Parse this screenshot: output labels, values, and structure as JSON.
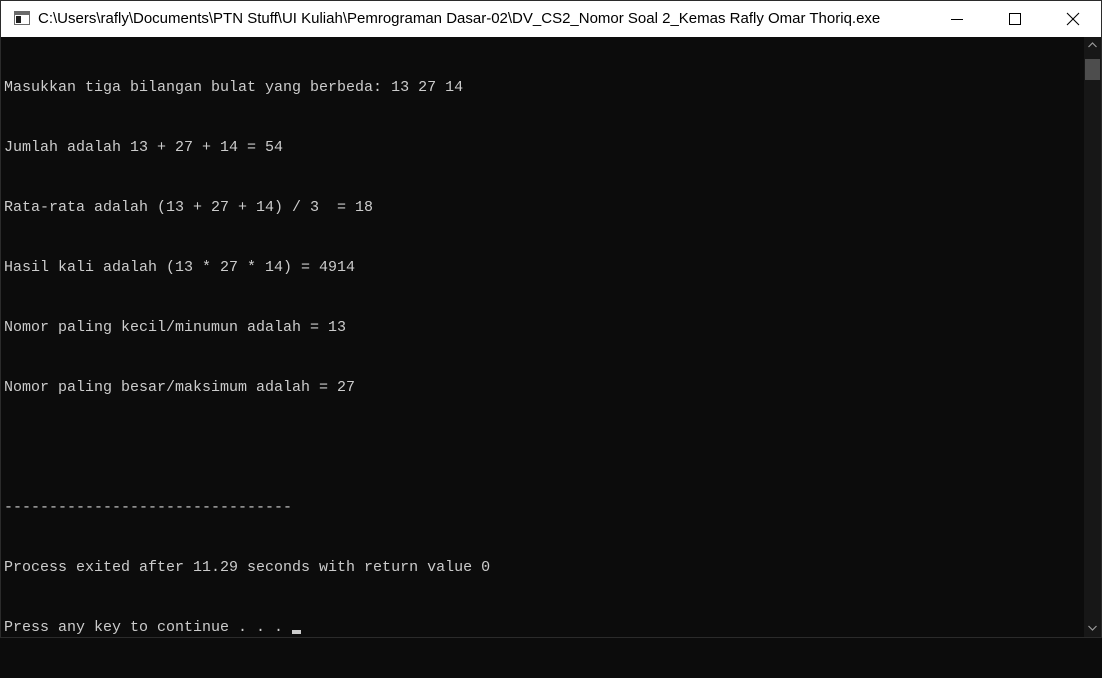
{
  "window": {
    "title": "C:\\Users\\rafly\\Documents\\PTN Stuff\\UI Kuliah\\Pemrograman Dasar-02\\DV_CS2_Nomor Soal 2_Kemas Rafly Omar Thoriq.exe",
    "icon": "console-app-icon",
    "controls": {
      "minimize": "minimize-icon",
      "maximize": "maximize-icon",
      "close": "close-icon"
    }
  },
  "console": {
    "lines": [
      "Masukkan tiga bilangan bulat yang berbeda: 13 27 14",
      "Jumlah adalah 13 + 27 + 14 = 54",
      "Rata-rata adalah (13 + 27 + 14) / 3  = 18",
      "Hasil kali adalah (13 * 27 * 14) = 4914",
      "Nomor paling kecil/minumun adalah = 13",
      "Nomor paling besar/maksimum adalah = 27",
      "",
      "--------------------------------",
      "Process exited after 11.29 seconds with return value 0",
      "Press any key to continue . . . "
    ]
  },
  "colors": {
    "console_background": "#0c0c0c",
    "console_text": "#cccccc",
    "titlebar_background": "#ffffff"
  }
}
